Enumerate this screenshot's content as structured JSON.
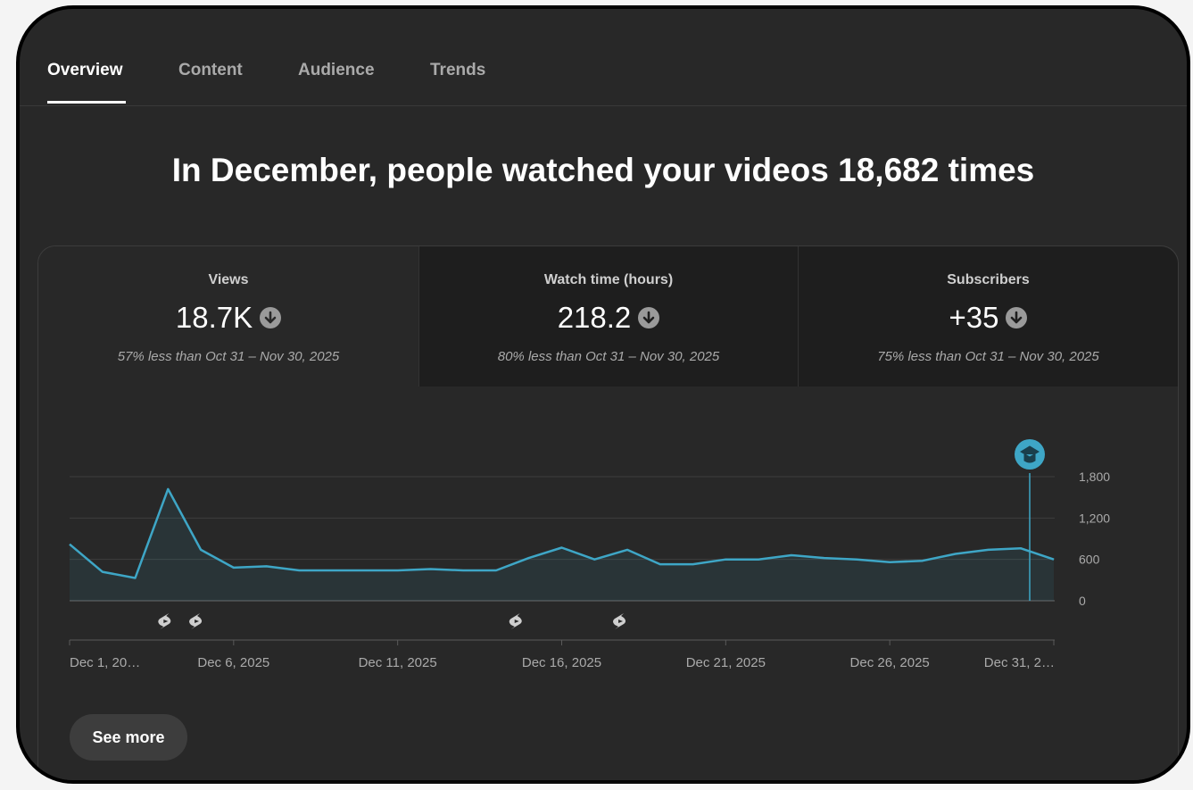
{
  "tabs": [
    {
      "label": "Overview",
      "active": true
    },
    {
      "label": "Content",
      "active": false
    },
    {
      "label": "Audience",
      "active": false
    },
    {
      "label": "Trends",
      "active": false
    }
  ],
  "headline": "In December, people watched your videos 18,682 times",
  "metrics": [
    {
      "label": "Views",
      "value": "18.7K",
      "trend_icon": "arrow-down-circle-icon",
      "comparison": "57% less than Oct 31 – Nov 30, 2025"
    },
    {
      "label": "Watch time (hours)",
      "value": "218.2",
      "trend_icon": "arrow-down-circle-icon",
      "comparison": "80% less than Oct 31 – Nov 30, 2025"
    },
    {
      "label": "Subscribers",
      "value": "+35",
      "trend_icon": "arrow-down-circle-icon",
      "comparison": "75% less than Oct 31 – Nov 30, 2025"
    }
  ],
  "see_more_label": "See more",
  "colors": {
    "line": "#3ea6c6",
    "marker": "#3ea6c6",
    "background": "#282828"
  },
  "chart_data": {
    "type": "area",
    "series": [
      {
        "values": [
          820,
          420,
          330,
          1620,
          740,
          480,
          500,
          440,
          440,
          440,
          440,
          460,
          440,
          440,
          620,
          770,
          600,
          740,
          530,
          530,
          600,
          600,
          660,
          620,
          600,
          560,
          580,
          680,
          740,
          760,
          600
        ]
      }
    ],
    "x": [
      "Dec 1, 2025",
      "Dec 2, 2025",
      "Dec 3, 2025",
      "Dec 4, 2025",
      "Dec 5, 2025",
      "Dec 6, 2025",
      "Dec 7, 2025",
      "Dec 8, 2025",
      "Dec 9, 2025",
      "Dec 10, 2025",
      "Dec 11, 2025",
      "Dec 12, 2025",
      "Dec 13, 2025",
      "Dec 14, 2025",
      "Dec 15, 2025",
      "Dec 16, 2025",
      "Dec 17, 2025",
      "Dec 18, 2025",
      "Dec 19, 2025",
      "Dec 20, 2025",
      "Dec 21, 2025",
      "Dec 22, 2025",
      "Dec 23, 2025",
      "Dec 24, 2025",
      "Dec 25, 2025",
      "Dec 26, 2025",
      "Dec 27, 2025",
      "Dec 28, 2025",
      "Dec 29, 2025",
      "Dec 30, 2025",
      "Dec 31, 2025"
    ],
    "x_tick_labels": [
      "Dec 1, 20…",
      "Dec 6, 2025",
      "Dec 11, 2025",
      "Dec 16, 2025",
      "Dec 21, 2025",
      "Dec 26, 2025",
      "Dec 31, 2…"
    ],
    "x_tick_days": [
      1,
      6,
      11,
      16,
      21,
      26,
      31
    ],
    "y_ticks": [
      0,
      600,
      1200,
      1800
    ],
    "y_tick_labels": [
      "0",
      "600",
      "1,200",
      "1,800"
    ],
    "ylim": [
      0,
      1800
    ],
    "grid": true,
    "y_axis_side": "right",
    "shorts_marker_days": [
      4,
      5,
      15,
      18
    ],
    "shorts_icon": "shorts-icon",
    "highlight_day": 31,
    "highlight_icon": "graduation-cap-icon"
  }
}
